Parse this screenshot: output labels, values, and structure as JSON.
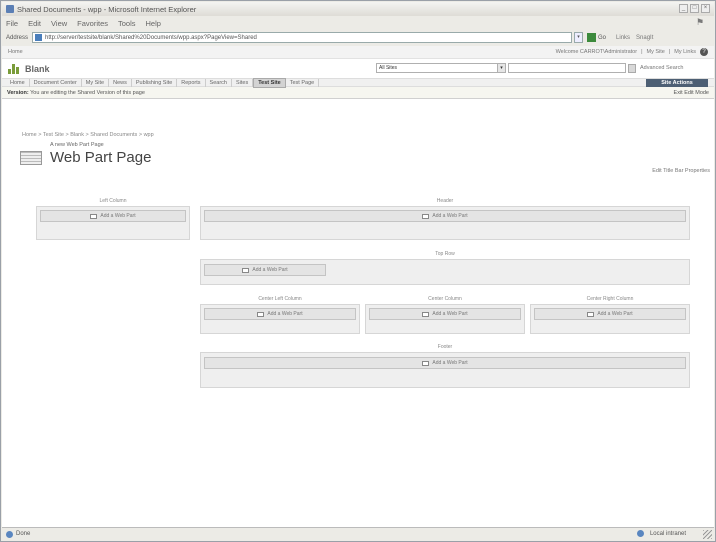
{
  "window": {
    "title": "Shared Documents - wpp - Microsoft Internet Explorer"
  },
  "menu": [
    "File",
    "Edit",
    "View",
    "Favorites",
    "Tools",
    "Help"
  ],
  "address": {
    "label": "Address",
    "url": "http://server/testsite/blank/Shared%20Documents/wpp.aspx?PageView=Shared",
    "go_label": "Go",
    "links_label": "Links",
    "snagit_label": "SnagIt"
  },
  "sharepoint": {
    "home_label": "Home",
    "welcome": "Welcome CARROT\\Administrator",
    "my_site": "My Site",
    "my_links": "My Links",
    "site_name": "Blank",
    "search_scope": "All Sites",
    "advanced_search": "Advanced Search",
    "nav_tabs": [
      {
        "label": "Home",
        "active": false
      },
      {
        "label": "Document Center",
        "active": false
      },
      {
        "label": "My Site",
        "active": false
      },
      {
        "label": "News",
        "active": false
      },
      {
        "label": "Publishing Site",
        "active": false
      },
      {
        "label": "Reports",
        "active": false
      },
      {
        "label": "Search",
        "active": false
      },
      {
        "label": "Sites",
        "active": false
      },
      {
        "label": "Test Site",
        "active": true
      },
      {
        "label": "Test Page",
        "active": false
      }
    ],
    "site_actions": "Site Actions",
    "version_label": "Version:",
    "version_text": "You are editing the Shared Version of this page",
    "exit_edit": "Exit Edit Mode",
    "breadcrumb": "Home > Test Site > Blank > Shared Documents > wpp",
    "page_subtitle": "A new Web Part Page",
    "page_title": "Web Part Page",
    "edit_title_bar": "Edit Title Bar Properties"
  },
  "zones": {
    "left": "Left Column",
    "header": "Header",
    "top_row": "Top Row",
    "center_left": "Center Left Column",
    "center": "Center Column",
    "center_right": "Center Right Column",
    "footer": "Footer",
    "add_web_part": "Add a Web Part"
  },
  "status": {
    "left": "Done",
    "zone": "Local intranet"
  }
}
